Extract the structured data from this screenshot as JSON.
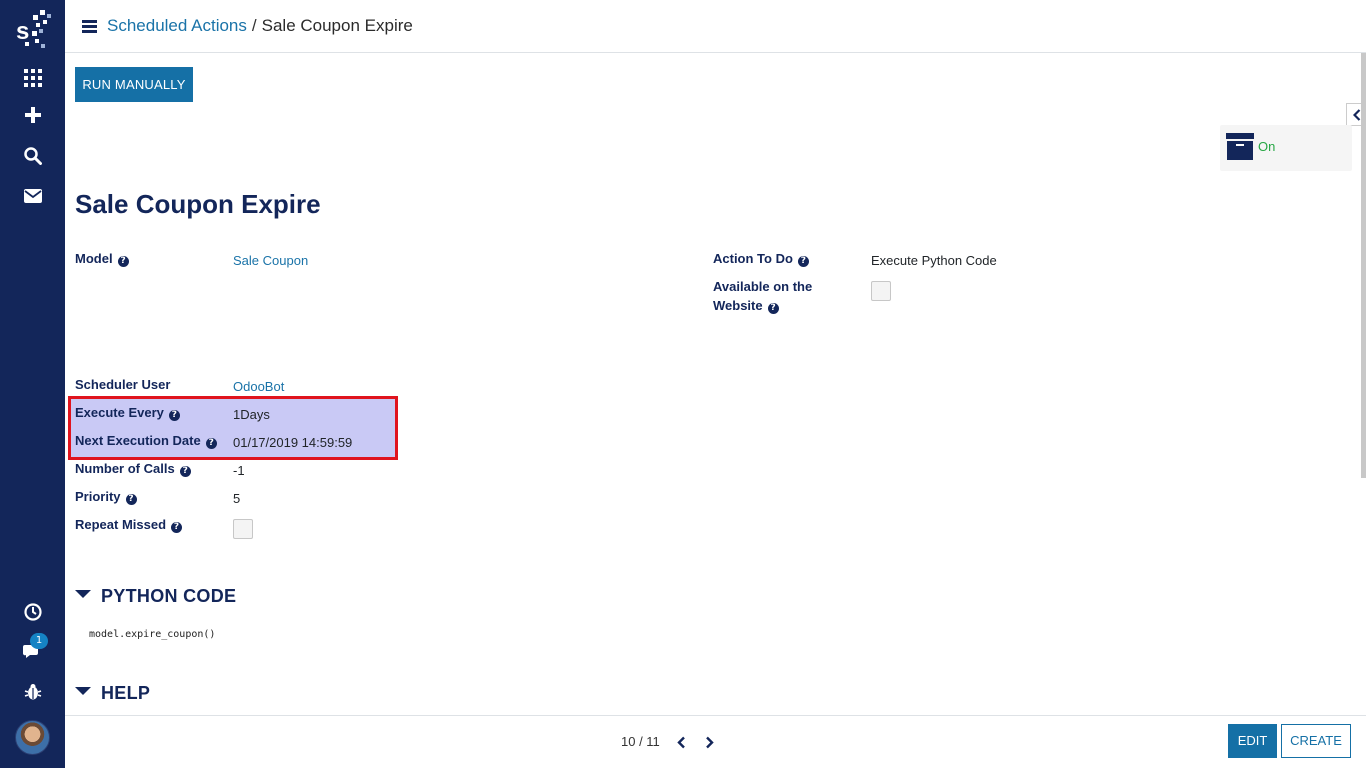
{
  "header": {
    "breadcrumb_parent": "Scheduled Actions",
    "breadcrumb_separator": "/",
    "breadcrumb_current": "Sale Coupon Expire"
  },
  "toolbar": {
    "run_manually_label": "RUN MANUALLY"
  },
  "archive": {
    "status_label": "On"
  },
  "record": {
    "title": "Sale Coupon Expire",
    "fields": {
      "model_label": "Model",
      "model_value": "Sale Coupon",
      "action_label": "Action To Do",
      "action_value": "Execute Python Code",
      "website_label_line1": "Available on the",
      "website_label_line2": "Website",
      "user_label": "Scheduler User",
      "user_value": "OdooBot",
      "interval_label": "Execute Every",
      "interval_value": "1Days",
      "next_label": "Next Execution Date",
      "next_value": "01/17/2019 14:59:59",
      "calls_label": "Number of Calls",
      "calls_value": "-1",
      "priority_label": "Priority",
      "priority_value": "5",
      "repeat_label": "Repeat Missed"
    },
    "help_glyph": "?"
  },
  "sections": {
    "python_title": "PYTHON CODE",
    "python_code": "model.expire_coupon()",
    "help_title": "HELP"
  },
  "sidebar": {
    "notification_count": "1"
  },
  "footer": {
    "pager": "10 / 11",
    "edit_label": "EDIT",
    "create_label": "CREATE"
  },
  "colors": {
    "sidebar": "#13265a",
    "primary": "#1570a6",
    "highlight_border": "#e0141e",
    "highlight_fill": "#c9c9f5",
    "active_status": "#28a745"
  }
}
